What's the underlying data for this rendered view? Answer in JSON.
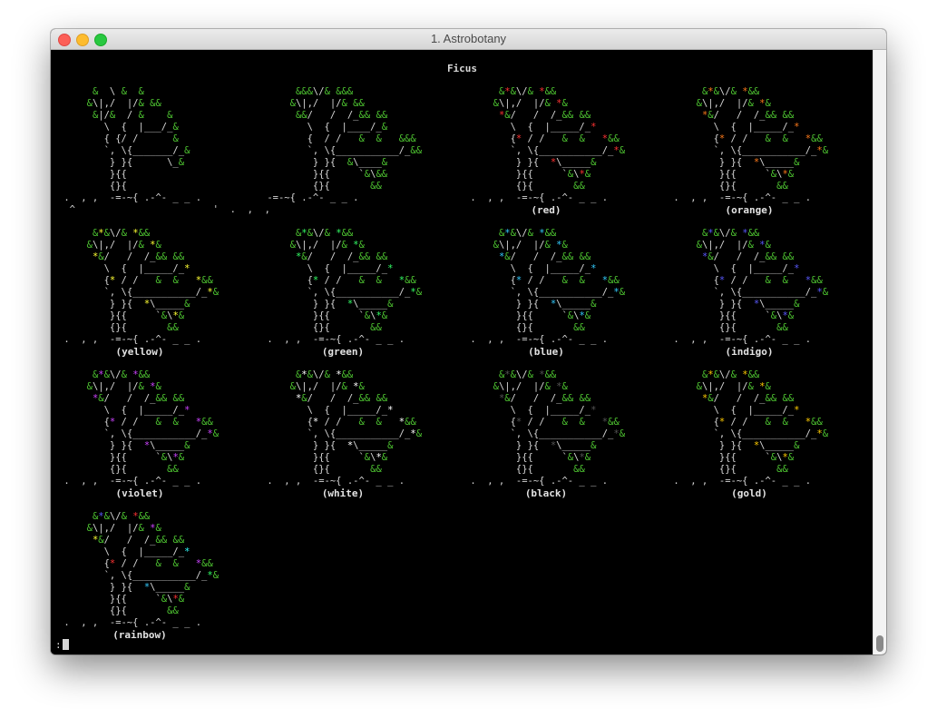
{
  "window": {
    "title": "1. Astrobotany"
  },
  "heading": "Ficus",
  "command_prompt": ":",
  "star_colors": {
    "red": "#ff3333",
    "orange": "#ff7a1a",
    "yellow": "#ffff33",
    "green": "#33ff66",
    "blue": "#33ccff",
    "indigo": "#5a5aff",
    "violet": "#cc44ff",
    "white": "#ffffff",
    "black": "#555555",
    "gold": "#ffcc00"
  },
  "plants": [
    {
      "label": "",
      "stars": null,
      "variant": "dead"
    },
    {
      "label": "",
      "stars": null,
      "variant": "plain"
    },
    {
      "label": "(red)",
      "stars": "red"
    },
    {
      "label": "(orange)",
      "stars": "orange"
    },
    {
      "label": "(yellow)",
      "stars": "yellow"
    },
    {
      "label": "(green)",
      "stars": "green"
    },
    {
      "label": "(blue)",
      "stars": "blue"
    },
    {
      "label": "(indigo)",
      "stars": "indigo"
    },
    {
      "label": "(violet)",
      "stars": "violet"
    },
    {
      "label": "(white)",
      "stars": "white"
    },
    {
      "label": "(black)",
      "stars": "black"
    },
    {
      "label": "(gold)",
      "stars": "gold"
    },
    {
      "label": "(rainbow)",
      "stars": "rainbow"
    }
  ],
  "art": {
    "dead": [
      "      &  \\ &  &",
      "     &\\|,/  |/& &&",
      "      &|/&  / &    &",
      "        \\  {  |___/_&",
      "        { {/ /      &",
      "        `, \\{_______/_&",
      "         } }{      \\_&",
      "         }{{",
      "         {}{",
      " .  , ,  -=-~{ .-^- _ _ .",
      "  ^                        '  .  ,  ,"
    ],
    "plain": [
      "      &&&\\/& &&&",
      "     &\\|,/  |/& &&",
      "      &&/   /  /_&& &&",
      "        \\  {  |____/_&",
      "        {  / /   &  &   &&&",
      "        `, \\{___________/_&&",
      "         } }{  &\\____&",
      "         }{{     `&\\&&",
      "         {}{       &&",
      " -=-~{ .-^- _ _ ."
    ],
    "starred": [
      "      &*&\\/& *&&",
      "     &\\|,/  |/& *&",
      "      *&/   /  /_&& &&",
      "        \\  {  |_____/_*",
      "        {* / /   &  &   *&&",
      "        `, \\{___________/_*&",
      "         } }{  *\\_____&",
      "         }{{     `&\\*&",
      "         {}{       &&",
      " .  , ,  -=-~{ .-^- _ _ ."
    ]
  }
}
